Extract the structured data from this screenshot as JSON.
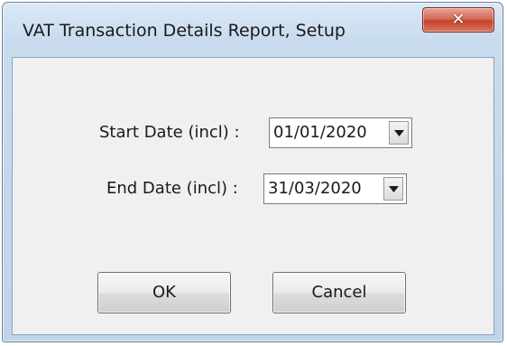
{
  "window": {
    "title": "VAT Transaction Details Report, Setup"
  },
  "fields": {
    "start_date": {
      "label": "Start Date (incl) :",
      "value": "01/01/2020"
    },
    "end_date": {
      "label": "End Date (incl) :",
      "value": "31/03/2020"
    }
  },
  "buttons": {
    "ok_label": "OK",
    "cancel_label": "Cancel"
  },
  "icons": {
    "close": "close-icon",
    "dropdown": "chevron-down-icon"
  },
  "colors": {
    "close_button": "#c3432d",
    "title_bar": "#c9dcef",
    "client_background": "#f0f0f0"
  }
}
